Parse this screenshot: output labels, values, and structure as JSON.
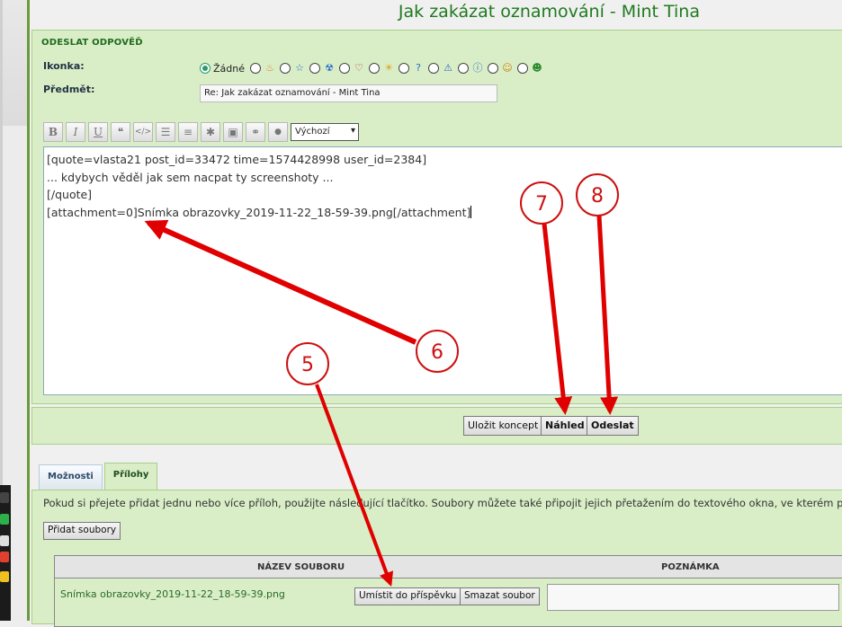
{
  "page": {
    "title": "Jak zakázat oznamování - Mint Tina"
  },
  "reply": {
    "section_title": "ODESLAT ODPOVĚĎ",
    "icon_label": "Ikonka:",
    "icon_none_label": "Žádné",
    "icons": [
      "fire-icon",
      "star-icon",
      "radioactive-icon",
      "heart-icon",
      "sun-icon",
      "question-icon",
      "warning-icon",
      "info-icon",
      "smile-icon",
      "grin-icon"
    ],
    "subject_label": "Předmět:",
    "subject_value": "Re: Jak zakázat oznamování - Mint Tina"
  },
  "toolbar": {
    "bold": "B",
    "italic": "I",
    "underline": "U",
    "quote": "❝",
    "code": "</>",
    "list": "☰",
    "numlist": "≡",
    "star": "✱",
    "image": "▣",
    "link": "⚭",
    "drop": "●",
    "font_select_value": "Výchozí"
  },
  "editor": {
    "lines": [
      "[quote=vlasta21 post_id=33472 time=1574428998 user_id=2384]",
      "... kdybych věděl jak sem nacpat ty screenshoty ...",
      "[/quote]",
      "[attachment=0]Snímka obrazovky_2019-11-22_18-59-39.png[/attachment]"
    ]
  },
  "buttons": {
    "save_draft": "Uložit koncept",
    "preview": "Náhled",
    "submit": "Odeslat"
  },
  "tabs": {
    "options": "Možnosti",
    "attachments": "Přílohy"
  },
  "attachments": {
    "info": "Pokud si přejete přidat jednu nebo více příloh, použijte následující tlačítko. Soubory můžete také připojit jejich přetažením do textového okna, ve kterém píšete pi",
    "add_files": "Přidat soubory",
    "col_filename": "NÁZEV SOUBORU",
    "col_note": "POZNÁMKA",
    "file_name": "Snímka obrazovky_2019-11-22_18-59-39.png",
    "place_in_post": "Umístit do příspěvku",
    "delete_file": "Smazat soubor"
  },
  "annotations": {
    "marker_5": "5",
    "marker_6": "6",
    "marker_7": "7",
    "marker_8": "8",
    "color": "#e00000"
  },
  "colors": {
    "panel_bg": "#d9eec6",
    "title_green": "#1f7a1f",
    "border_green": "#6a9a3c"
  }
}
